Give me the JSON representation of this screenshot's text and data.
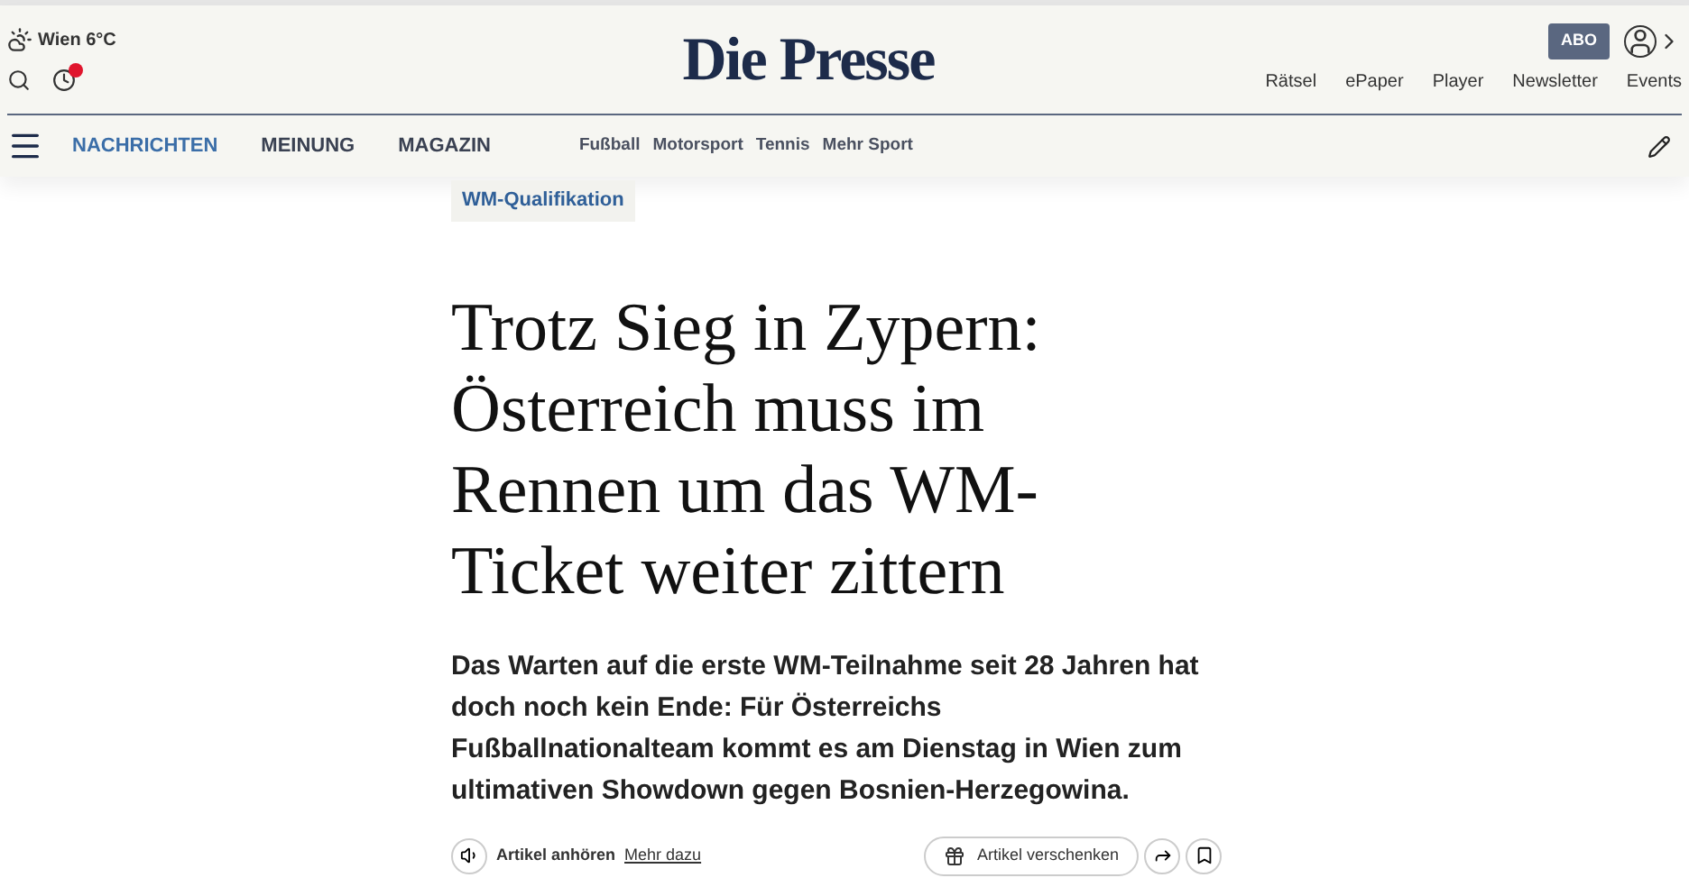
{
  "weather": {
    "text": "Wien 6°C"
  },
  "logo": "Die Presse",
  "abo_button": "ABO",
  "top_links": [
    "Rätsel",
    "ePaper",
    "Player",
    "Newsletter",
    "Events"
  ],
  "notification": {
    "unread": true
  },
  "main_nav": [
    {
      "label": "NACHRICHTEN",
      "selected": true
    },
    {
      "label": "MEINUNG",
      "selected": false
    },
    {
      "label": "MAGAZIN",
      "selected": false
    }
  ],
  "sub_nav": [
    "Fußball",
    "Motorsport",
    "Tennis",
    "Mehr Sport"
  ],
  "article": {
    "tag": "WM-Qualifikation",
    "headline": "Trotz Sieg in Zypern: Österreich muss im Rennen um das WM-Ticket weiter zittern",
    "lead": "Das Warten auf die erste WM-Teilnahme seit 28 Jahren hat doch noch kein Ende: Für Österreichs Fußballnationalteam kommt es am Dienstag in Wien zum ultimativen Showdown gegen Bosnien-Herzegowina.",
    "listen": "Artikel anhören",
    "more": "Mehr dazu",
    "gift": "Artikel verschenken"
  }
}
